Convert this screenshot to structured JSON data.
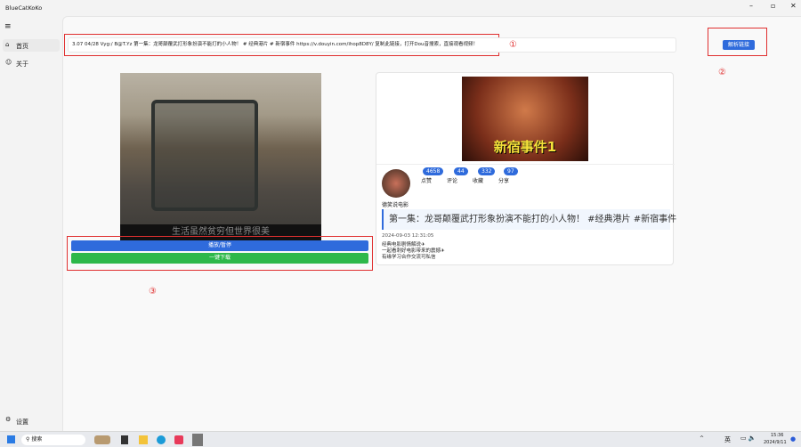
{
  "app": {
    "title": "BlueCatKoKo",
    "window_controls": [
      "minimize",
      "restore",
      "close"
    ]
  },
  "sidebar": {
    "items": [
      {
        "label": "首页",
        "icon": "home-icon"
      },
      {
        "label": "关于",
        "icon": "person-icon"
      }
    ],
    "settings": "设置"
  },
  "input": {
    "value": "3.07 04/28 Vyg:/ B@T.Yz 第一集：龙哥颠覆武打形象扮演不能打的小人物！ # 经典港片 # 新宿事件  https://v.douyin.com/ihop8D8Y/ 复制此链接，打开Dou音搜索，直接观看视频！"
  },
  "parse_button": "解析链接",
  "markers": [
    "①",
    "②",
    "③"
  ],
  "video": {
    "subtitle": "生活虽然贫穷但世界很美",
    "play_button": "播放/暂停",
    "download_button": "一键下载"
  },
  "info": {
    "thumbnail_text": "新宿事件1",
    "author": "德笑说电影",
    "stats": [
      {
        "count": "4658",
        "label": "点赞"
      },
      {
        "count": "44",
        "label": "评论"
      },
      {
        "count": "332",
        "label": "收藏"
      },
      {
        "count": "97",
        "label": "分享"
      }
    ],
    "title": "第一集：龙哥颠覆武打形象扮演不能打的小人物！ #经典港片 #新宿事件",
    "date": "2024-09-03 12:31:05",
    "desc": [
      "经典电影剧情解说✈",
      "一起看刺好电影带来的震撼✈",
      "有缘学习合作交流可私信"
    ]
  },
  "taskbar": {
    "search": "搜索",
    "tray": [
      "^",
      "英"
    ],
    "time": "15:36",
    "date": "2024/9/11"
  },
  "colors": {
    "accent": "#2f6bdc",
    "download": "#2db84a",
    "annotation": "#e03030"
  }
}
